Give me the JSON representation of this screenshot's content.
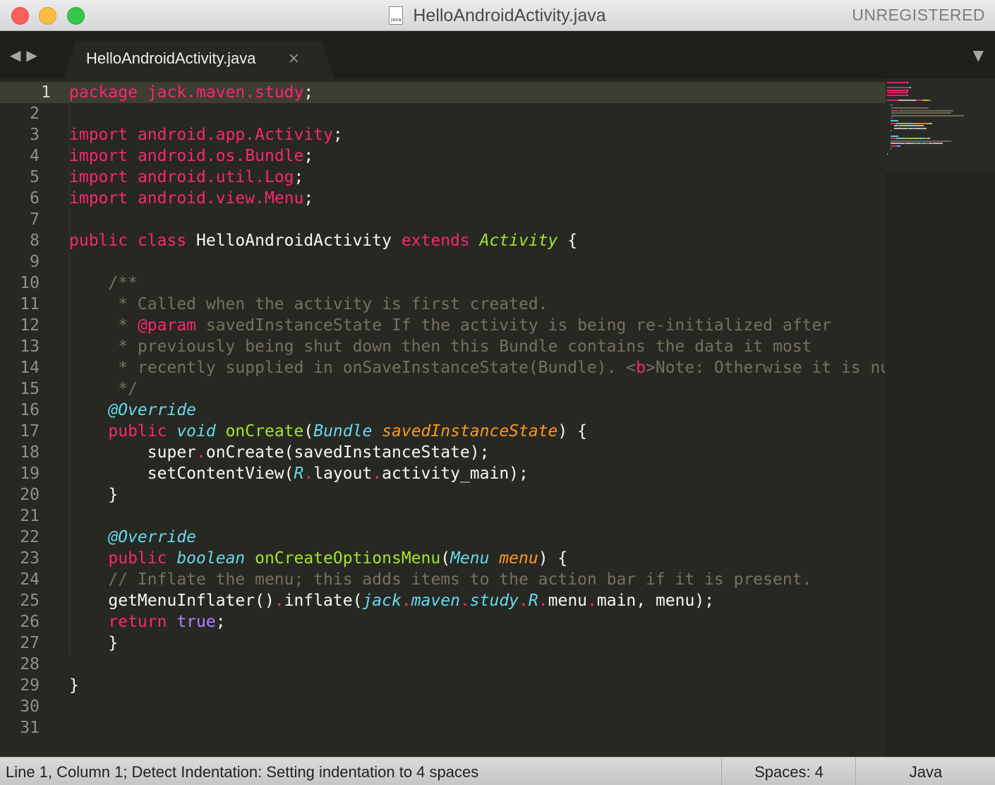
{
  "window": {
    "title": "HelloAndroidActivity.java",
    "file_icon_label": "java",
    "license_status": "UNREGISTERED"
  },
  "tabs": {
    "nav_back": "◀",
    "nav_forward": "▶",
    "active_label": "HelloAndroidActivity.java",
    "close_glyph": "×",
    "dropdown_glyph": "▼"
  },
  "editor": {
    "current_line": 1,
    "line_count": 31,
    "line_numbers": [
      "1",
      "2",
      "3",
      "4",
      "5",
      "6",
      "7",
      "8",
      "9",
      "10",
      "11",
      "12",
      "13",
      "14",
      "15",
      "16",
      "17",
      "18",
      "19",
      "20",
      "21",
      "22",
      "23",
      "24",
      "25",
      "26",
      "27",
      "28",
      "29",
      "30",
      "31"
    ],
    "colors": {
      "background": "#272822",
      "keyword": "#f92672",
      "storage_type": "#66d9ef",
      "class_name": "#a6e22e",
      "parameter": "#fd971f",
      "comment": "#75715e",
      "constant": "#ae81ff"
    },
    "lines": [
      [
        {
          "t": "package jack",
          "c": "kw"
        },
        {
          "t": ".",
          "c": "dot"
        },
        {
          "t": "maven",
          "c": "kw"
        },
        {
          "t": ".",
          "c": "dot"
        },
        {
          "t": "study",
          "c": "kw"
        },
        {
          "t": ";"
        }
      ],
      [],
      [
        {
          "t": "import ",
          "c": "kw"
        },
        {
          "t": "android",
          "c": "kw"
        },
        {
          "t": ".",
          "c": "dot"
        },
        {
          "t": "app",
          "c": "kw"
        },
        {
          "t": ".",
          "c": "dot"
        },
        {
          "t": "Activity",
          "c": "kw"
        },
        {
          "t": ";"
        }
      ],
      [
        {
          "t": "import ",
          "c": "kw"
        },
        {
          "t": "android",
          "c": "kw"
        },
        {
          "t": ".",
          "c": "dot"
        },
        {
          "t": "os",
          "c": "kw"
        },
        {
          "t": ".",
          "c": "dot"
        },
        {
          "t": "Bundle",
          "c": "kw"
        },
        {
          "t": ";"
        }
      ],
      [
        {
          "t": "import ",
          "c": "kw"
        },
        {
          "t": "android",
          "c": "kw"
        },
        {
          "t": ".",
          "c": "dot"
        },
        {
          "t": "util",
          "c": "kw"
        },
        {
          "t": ".",
          "c": "dot"
        },
        {
          "t": "Log",
          "c": "kw"
        },
        {
          "t": ";"
        }
      ],
      [
        {
          "t": "import ",
          "c": "kw"
        },
        {
          "t": "android",
          "c": "kw"
        },
        {
          "t": ".",
          "c": "dot"
        },
        {
          "t": "view",
          "c": "kw"
        },
        {
          "t": ".",
          "c": "dot"
        },
        {
          "t": "Menu",
          "c": "kw"
        },
        {
          "t": ";"
        }
      ],
      [],
      [
        {
          "t": "public class ",
          "c": "kw"
        },
        {
          "t": "HelloAndroidActivity "
        },
        {
          "t": "extends ",
          "c": "kw"
        },
        {
          "t": "Activity",
          "c": "cls"
        },
        {
          "t": " {"
        }
      ],
      [],
      [
        {
          "t": "    /**",
          "c": "cm"
        }
      ],
      [
        {
          "t": "     * Called when the activity is first created.",
          "c": "cm"
        }
      ],
      [
        {
          "t": "     * ",
          "c": "cm"
        },
        {
          "t": "@param",
          "c": "kw"
        },
        {
          "t": " savedInstanceState If the activity is being re-initialized after",
          "c": "cm"
        }
      ],
      [
        {
          "t": "     * previously being shut down then this Bundle contains the data it most",
          "c": "cm"
        }
      ],
      [
        {
          "t": "     * recently supplied in onSaveInstanceState(Bundle). <",
          "c": "cm"
        },
        {
          "t": "b",
          "c": "kw"
        },
        {
          "t": ">Note: Otherwise it is null.</b>",
          "c": "cm"
        }
      ],
      [
        {
          "t": "     */",
          "c": "cm"
        }
      ],
      [
        {
          "t": "    "
        },
        {
          "t": "@Override",
          "c": "st"
        }
      ],
      [
        {
          "t": "    "
        },
        {
          "t": "public ",
          "c": "kw"
        },
        {
          "t": "void ",
          "c": "st"
        },
        {
          "t": "onCreate",
          "c": "fn"
        },
        {
          "t": "("
        },
        {
          "t": "Bundle ",
          "c": "st"
        },
        {
          "t": "savedInstanceState",
          "c": "prm"
        },
        {
          "t": ") {"
        }
      ],
      [
        {
          "t": "        super"
        },
        {
          "t": ".",
          "c": "dot"
        },
        {
          "t": "onCreate(savedInstanceState);"
        }
      ],
      [
        {
          "t": "        setContentView("
        },
        {
          "t": "R",
          "c": "st"
        },
        {
          "t": ".",
          "c": "dot"
        },
        {
          "t": "layout"
        },
        {
          "t": ".",
          "c": "dot"
        },
        {
          "t": "activity_main);"
        }
      ],
      [
        {
          "t": "    }"
        }
      ],
      [],
      [
        {
          "t": "    "
        },
        {
          "t": "@Override",
          "c": "st"
        }
      ],
      [
        {
          "t": "    "
        },
        {
          "t": "public ",
          "c": "kw"
        },
        {
          "t": "boolean ",
          "c": "st"
        },
        {
          "t": "onCreateOptionsMenu",
          "c": "fn"
        },
        {
          "t": "("
        },
        {
          "t": "Menu ",
          "c": "st"
        },
        {
          "t": "menu",
          "c": "prm"
        },
        {
          "t": ") {"
        }
      ],
      [
        {
          "t": "    // Inflate the menu; this adds items to the action bar if it is present.",
          "c": "cm"
        }
      ],
      [
        {
          "t": "    getMenuInflater()"
        },
        {
          "t": ".",
          "c": "dot"
        },
        {
          "t": "inflate("
        },
        {
          "t": "jack",
          "c": "st"
        },
        {
          "t": ".",
          "c": "dot"
        },
        {
          "t": "maven",
          "c": "st"
        },
        {
          "t": ".",
          "c": "dot"
        },
        {
          "t": "study",
          "c": "st"
        },
        {
          "t": ".",
          "c": "dot"
        },
        {
          "t": "R",
          "c": "st"
        },
        {
          "t": ".",
          "c": "dot"
        },
        {
          "t": "menu"
        },
        {
          "t": ".",
          "c": "dot"
        },
        {
          "t": "main, menu);"
        }
      ],
      [
        {
          "t": "    "
        },
        {
          "t": "return ",
          "c": "kw"
        },
        {
          "t": "true",
          "c": "num"
        },
        {
          "t": ";"
        }
      ],
      [
        {
          "t": "    }"
        }
      ],
      [],
      [
        {
          "t": "}"
        }
      ],
      [],
      []
    ]
  },
  "statusbar": {
    "message": "Line 1, Column 1; Detect Indentation: Setting indentation to 4 spaces",
    "indentation": "Spaces: 4",
    "syntax": "Java"
  }
}
